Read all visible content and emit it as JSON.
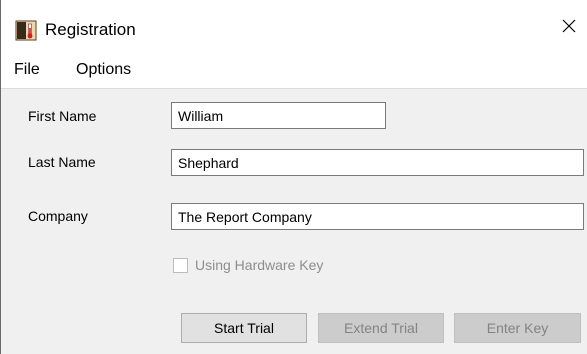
{
  "window": {
    "title": "Registration",
    "app_icon": "thermometer-icon",
    "close_icon": "close-icon"
  },
  "menu": {
    "items": [
      {
        "label": "File"
      },
      {
        "label": "Options"
      }
    ]
  },
  "form": {
    "first_name": {
      "label": "First Name",
      "value": "William"
    },
    "last_name": {
      "label": "Last Name",
      "value": "Shephard"
    },
    "company": {
      "label": "Company",
      "value": "The Report Company"
    },
    "hardware_key": {
      "label": "Using Hardware Key",
      "checked": false,
      "enabled": false
    }
  },
  "buttons": {
    "start_trial": {
      "label": "Start Trial",
      "enabled": true
    },
    "extend_trial": {
      "label": "Extend Trial",
      "enabled": false
    },
    "enter_key": {
      "label": "Enter Key",
      "enabled": false
    }
  },
  "colors": {
    "window_bg": "#f0f0f0",
    "titlebar_bg": "#ffffff",
    "disabled_text": "#838383"
  }
}
